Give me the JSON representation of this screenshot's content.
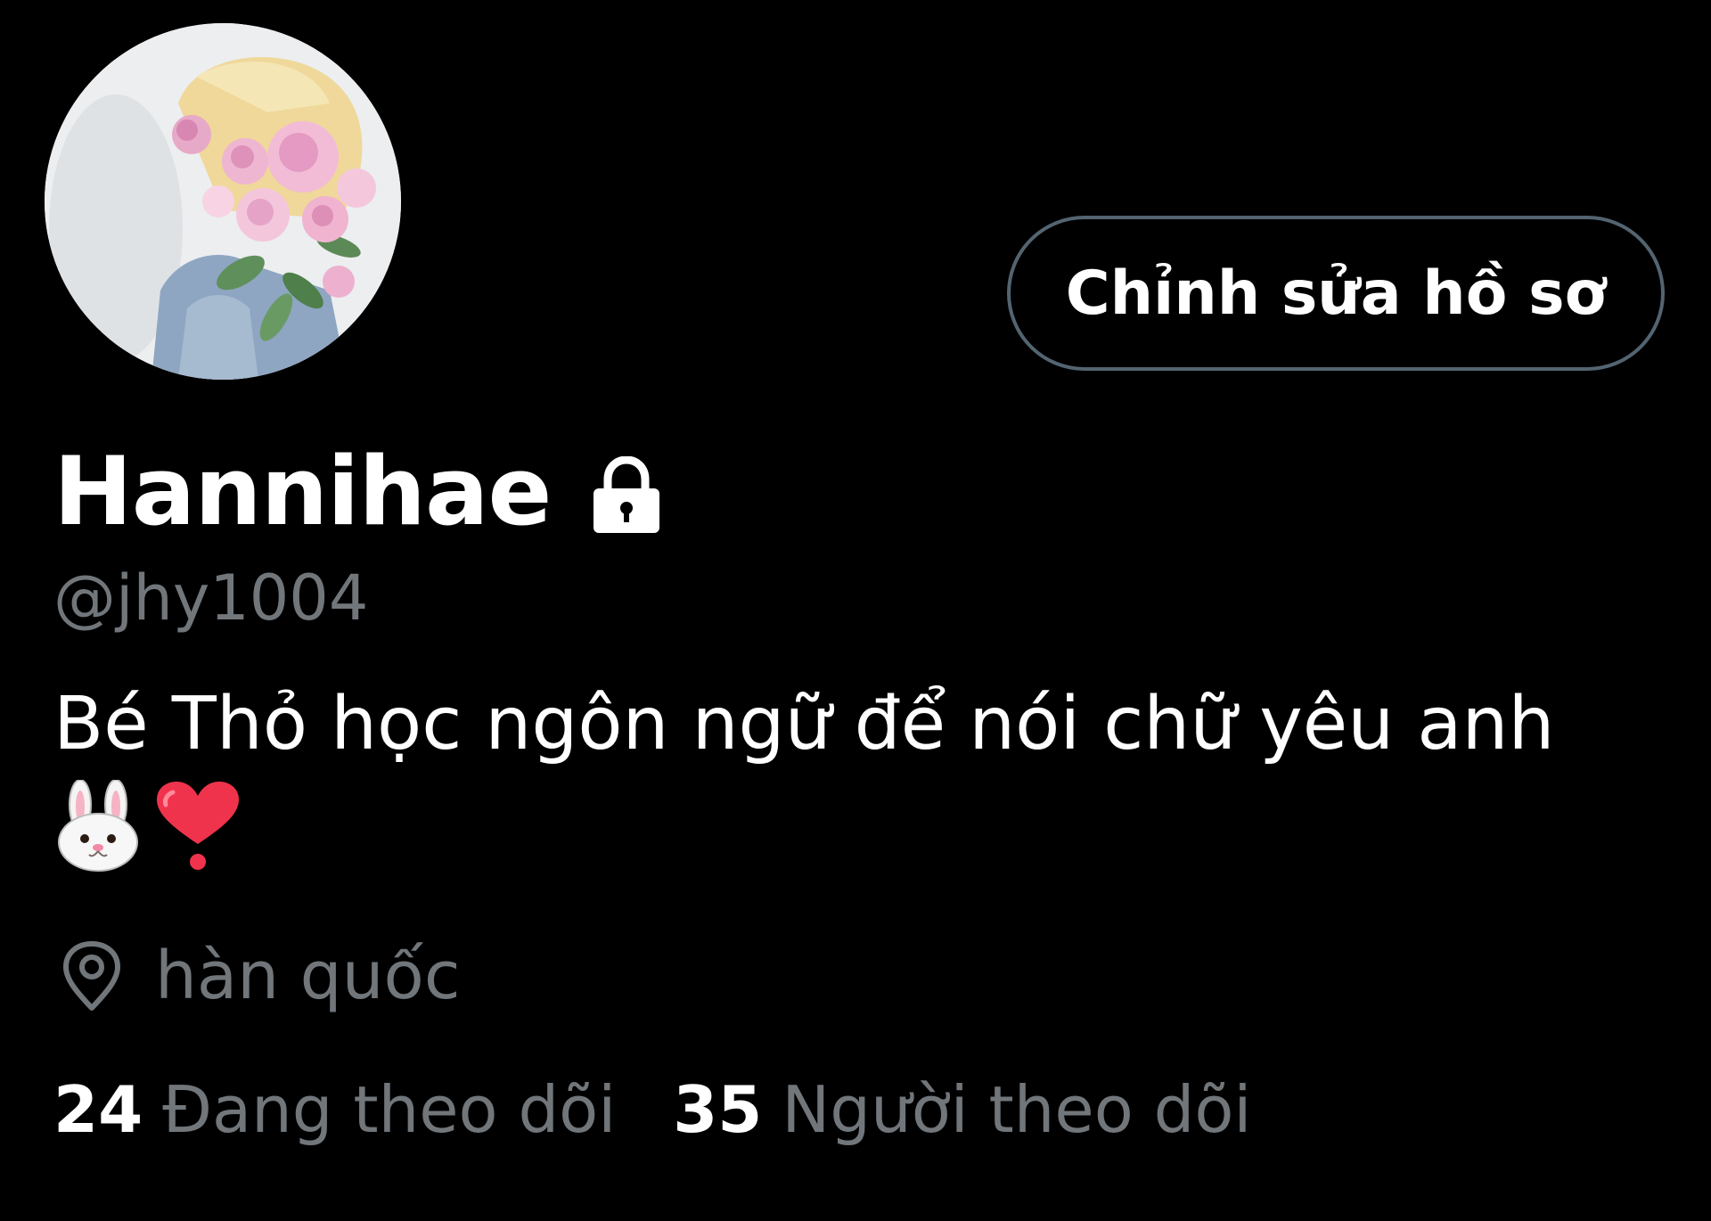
{
  "profile": {
    "avatar_icon": "profile-photo",
    "edit_button_label": "Chỉnh sửa hồ sơ",
    "display_name": "Hannihae",
    "protected_icon": "lock-icon",
    "handle": "@jhy1004",
    "bio_text": "Bé Thỏ học ngôn ngữ để nói chữ yêu anh",
    "bio_emojis": [
      "rabbit-face-emoji",
      "heart-exclamation-emoji"
    ],
    "location_icon": "location-pin-icon",
    "location": "hàn quốc",
    "following_count": "24",
    "following_label": "Đang theo dõi",
    "followers_count": "35",
    "followers_label": "Người theo dõi"
  },
  "colors": {
    "background": "#000000",
    "primary_text": "#ffffff",
    "secondary_text": "#71767b",
    "button_border": "#536471",
    "heart": "#f0334c"
  }
}
